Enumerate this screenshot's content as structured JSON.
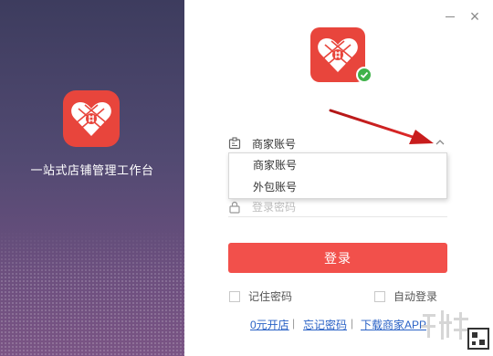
{
  "app": {
    "slogan": "一站式店铺管理工作台",
    "brand_color": "#e8453c"
  },
  "window_controls": {
    "minimize_icon": "minimize-icon",
    "close_symbol": "×"
  },
  "login_form": {
    "account_type": {
      "selected": "商家账号",
      "options": [
        "商家账号",
        "外包账号"
      ],
      "expanded": true
    },
    "password": {
      "placeholder": "登录密码",
      "value": ""
    },
    "submit_label": "登录",
    "remember_password": {
      "label": "记住密码",
      "checked": false
    },
    "auto_login": {
      "label": "自动登录",
      "checked": false
    },
    "links": {
      "open_store": "0元开店",
      "forgot_password": "忘记密码",
      "download_app": "下载商家APP"
    },
    "separator": "|"
  },
  "colors": {
    "primary_button": "#f2504b",
    "link": "#2a62c6",
    "verified": "#3fb24a",
    "annotation_arrow": "#d42020"
  }
}
